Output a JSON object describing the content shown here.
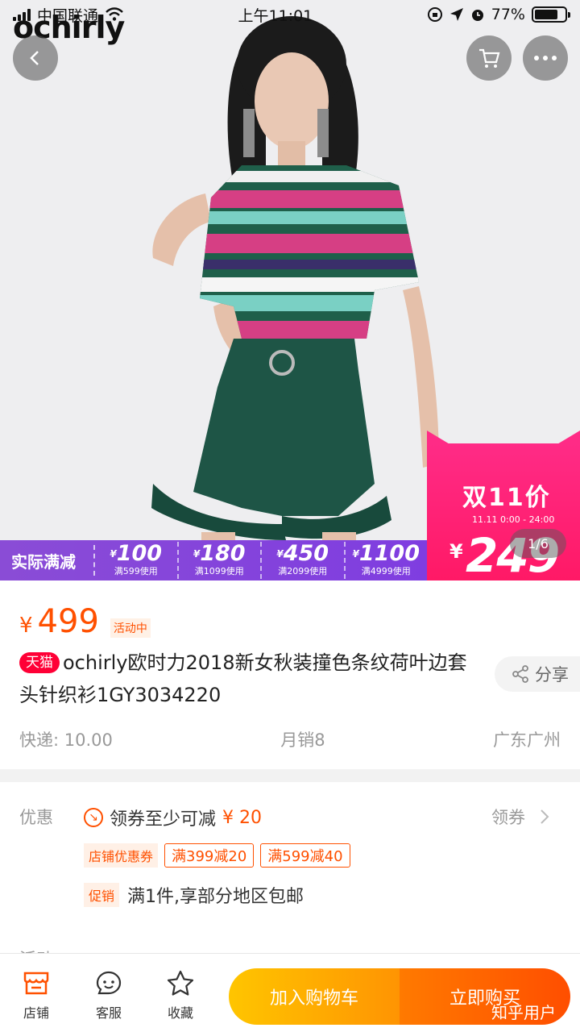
{
  "status_bar": {
    "carrier": "中国联通",
    "time": "上午11:01",
    "battery": "77%",
    "battery_level": 0.77
  },
  "hero": {
    "brand": "ochirly",
    "promo": {
      "title": "实际满减",
      "cells": [
        {
          "amount": "100",
          "condition": "满599使用"
        },
        {
          "amount": "180",
          "condition": "满1099使用"
        },
        {
          "amount": "450",
          "condition": "满2099使用"
        },
        {
          "amount": "1100",
          "condition": "满4999使用"
        }
      ]
    },
    "badge": {
      "title": "双11价",
      "time": "11.11 0:00 - 24:00",
      "currency": "¥",
      "price": "249"
    },
    "pager": "1/6"
  },
  "product": {
    "currency": "¥",
    "price": "499",
    "activity_tag": "活动中",
    "store_tag": "天猫",
    "title": "ochirly欧时力2018新女秋装撞色条纹荷叶边套头针织衫1GY3034220",
    "share_label": "分享",
    "shipping": "快递: 10.00",
    "monthly_sales": "月销8",
    "location": "广东广州"
  },
  "coupons": {
    "label": "优惠",
    "main_text": "领券至少可减",
    "main_amount": "¥ 20",
    "get_label": "领券",
    "store_coupon_tag": "店铺优惠券",
    "coupon_items": [
      "满399减20",
      "满599减40"
    ],
    "promo_tag": "促销",
    "promo_text": "满1件,享部分地区包邮",
    "activity_label": "活动"
  },
  "bottom_bar": {
    "store": "店铺",
    "service": "客服",
    "favorite": "收藏",
    "add_to_cart": "加入购物车",
    "buy_now": "立即购买"
  },
  "watermark": "知乎用户",
  "colors": {
    "accent": "#ff5000",
    "tmall_red": "#ff0036",
    "promo_purple": "#7f3de0",
    "badge_pink": "#ff1f6e"
  }
}
